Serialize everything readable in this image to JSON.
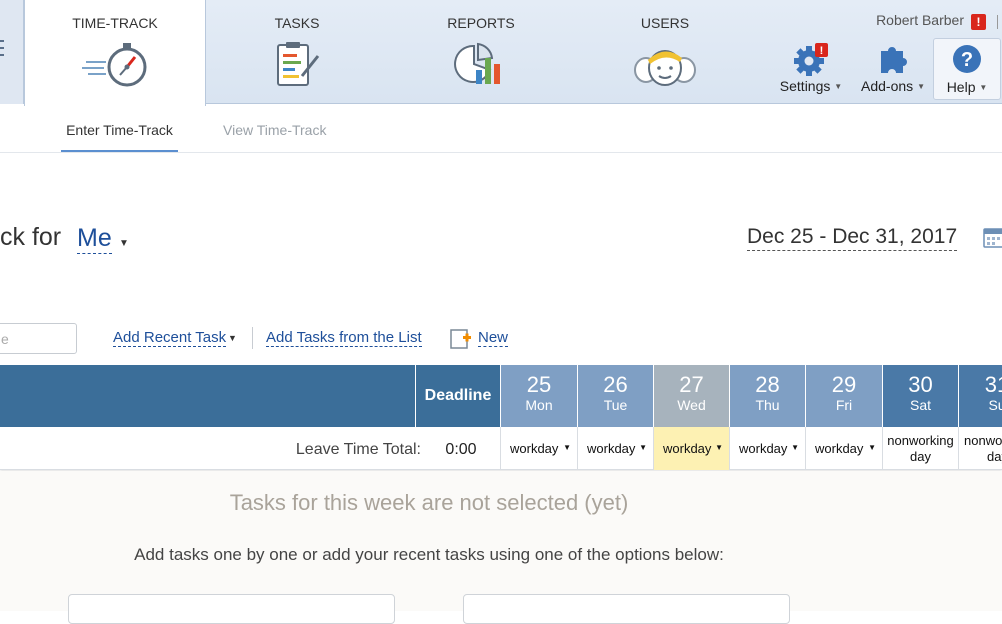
{
  "header": {
    "tabs": [
      {
        "label": "TIME-TRACK",
        "icon": "stopwatch-icon",
        "active": true
      },
      {
        "label": "TASKS",
        "icon": "clipboard-icon",
        "active": false
      },
      {
        "label": "REPORTS",
        "icon": "report-chart-icon",
        "active": false
      },
      {
        "label": "USERS",
        "icon": "users-icon",
        "active": false
      }
    ],
    "user_name": "Robert Barber",
    "alert_badge": "!",
    "tools": {
      "settings_label": "Settings",
      "settings_badge": "!",
      "addons_label": "Add-ons",
      "help_label": "Help"
    }
  },
  "subnav": {
    "enter_label": "Enter Time-Track",
    "view_label": "View Time-Track"
  },
  "title": {
    "prefix": "ck for",
    "user": "Me",
    "date_range": "Dec 25 - Dec 31, 2017"
  },
  "toolbar": {
    "search_placeholder": "e",
    "add_recent_label": "Add Recent Task",
    "add_from_list_label": "Add Tasks from the List",
    "new_label": "New"
  },
  "grid": {
    "deadline_label": "Deadline",
    "days": [
      {
        "num": "25",
        "dow": "Mon",
        "status": "workday",
        "color": "#7f9fc4"
      },
      {
        "num": "26",
        "dow": "Tue",
        "status": "workday",
        "color": "#7f9fc4"
      },
      {
        "num": "27",
        "dow": "Wed",
        "status": "workday",
        "color": "#a7b3bd",
        "today": true
      },
      {
        "num": "28",
        "dow": "Thu",
        "status": "workday",
        "color": "#7f9fc4"
      },
      {
        "num": "29",
        "dow": "Fri",
        "status": "workday",
        "color": "#7f9fc4"
      },
      {
        "num": "30",
        "dow": "Sat",
        "status_line1": "nonworking",
        "status_line2": "day",
        "color": "#4a79a7"
      },
      {
        "num": "31",
        "dow": "Su",
        "status_line1": "nonwor",
        "status_line2": "day",
        "color": "#4a79a7"
      }
    ],
    "leave_label": "Leave Time Total:",
    "leave_total": "0:00"
  },
  "empty_state": {
    "title": "Tasks for this week are not selected (yet)",
    "subtitle": "Add tasks one by one or add your recent tasks using one of the options below:"
  },
  "colors": {
    "header_bg": "#3b6e99",
    "link": "#1e4f9a",
    "today_highlight": "#fdf1b3",
    "alert": "#d9261c"
  }
}
